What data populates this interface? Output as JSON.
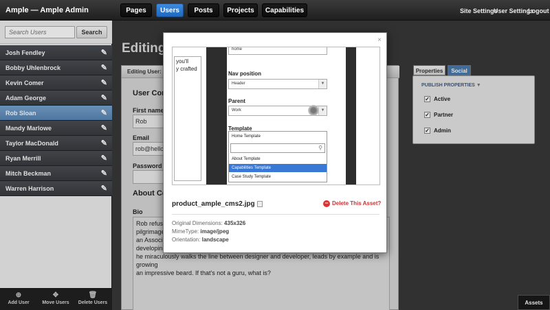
{
  "app": {
    "title": "Ample — Ample Admin"
  },
  "nav": {
    "tabs": [
      "Pages",
      "Users",
      "Posts",
      "Projects",
      "Capabilities"
    ],
    "active": "Users"
  },
  "top_links": [
    "Site Settings",
    "User Settings",
    "Logout"
  ],
  "sidebar": {
    "search_placeholder": "Search Users",
    "search_button": "Search",
    "users": [
      "Josh Fendley",
      "Bobby Uhlenbrock",
      "Kevin Comer",
      "Adam George",
      "Rob Sloan",
      "Mandy Marlowe",
      "Taylor MacDonald",
      "Ryan Merrill",
      "Mitch Beckman",
      "Warren Harrison"
    ],
    "selected_user": "Rob Sloan",
    "footer": [
      "Add User",
      "Move Users",
      "Delete Users"
    ]
  },
  "main": {
    "heading": "Editing",
    "tab_label": "Editing User: Ro",
    "section_contact": "User Cont",
    "first_name_label": "First name",
    "first_name_value": "Rob",
    "email_label": "Email",
    "email_value": "rob@helloa",
    "password_label": "Password",
    "section_about": "About Cor",
    "bio_label": "Bio",
    "bio_lines": [
      "Rob refuses",
      "pilgrimage c",
      "an Associati",
      "developing",
      "he miraculously walks the line between designer and developer, leads by example and is growing",
      "an impressive beard. If that's not a guru, what is?"
    ]
  },
  "properties": {
    "tabs": [
      "Properties",
      "Social"
    ],
    "title": "PUBLISH PROPERTIES",
    "items": [
      {
        "label": "Active",
        "checked": true
      },
      {
        "label": "Partner",
        "checked": true
      },
      {
        "label": "Admin",
        "checked": true
      }
    ],
    "assets_tab": "Assets"
  },
  "modal": {
    "close": "×",
    "preview": {
      "textarea_lines": [
        "you'll",
        "y crafted"
      ],
      "top_select_value": "home",
      "nav_position_label": "Nav position",
      "nav_position_value": "Header",
      "parent_label": "Parent",
      "parent_value": "Work",
      "template_label": "Template",
      "template_value": "Home Template",
      "options": [
        "About Template",
        "Capabilities Template",
        "Case Study Template"
      ],
      "highlighted_option": "Capabilities Template"
    },
    "file_name": "product_ample_cms2.jpg",
    "delete_label": "Delete This Asset?",
    "meta": {
      "dimensions_label": "Original Dimensions:",
      "dimensions_value": "435x326",
      "mime_label": "MimeType:",
      "mime_value": "image/jpeg",
      "orientation_label": "Orientation:",
      "orientation_value": "landscape"
    }
  },
  "colors": {
    "accent": "#2a76d2",
    "selected_row": "#6a96c4",
    "delete": "#cc3333"
  }
}
